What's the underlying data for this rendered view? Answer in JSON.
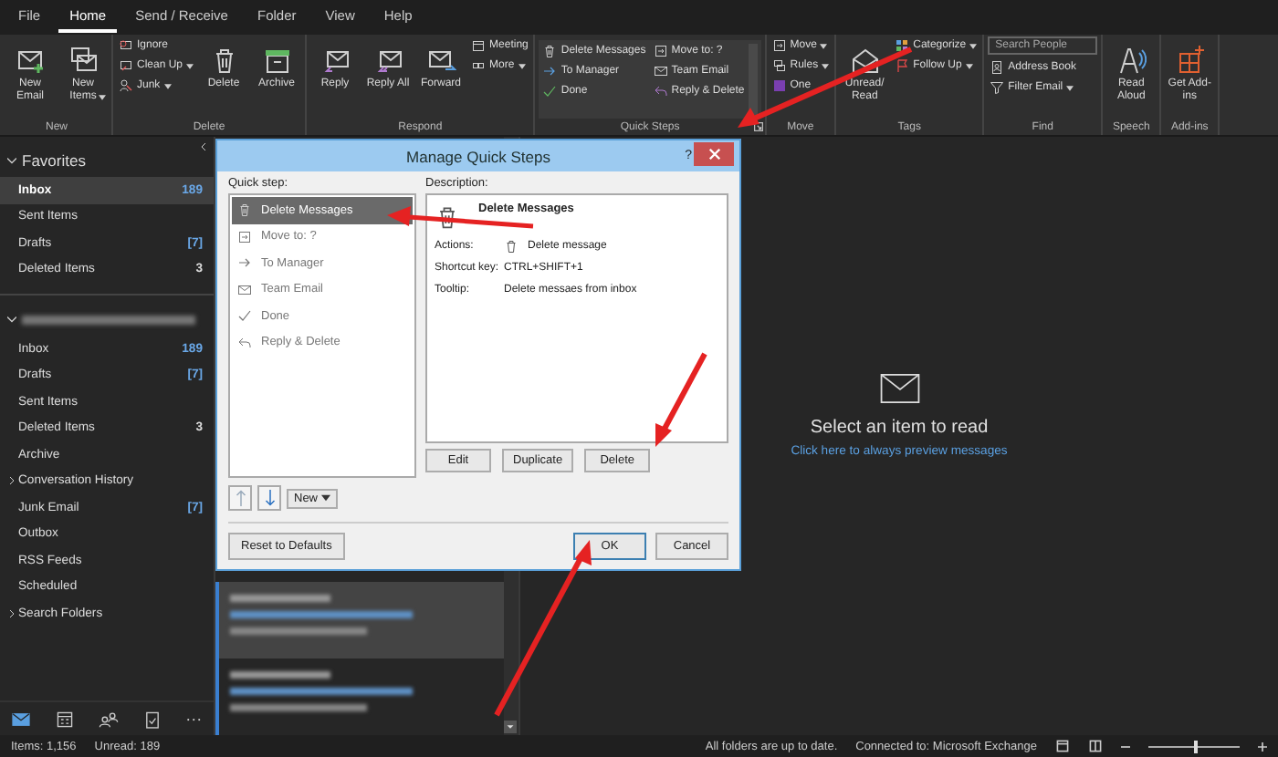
{
  "menu_tabs": [
    {
      "label": "File",
      "selected": false
    },
    {
      "label": "Home",
      "selected": true
    },
    {
      "label": "Send / Receive",
      "selected": false
    },
    {
      "label": "Folder",
      "selected": false
    },
    {
      "label": "View",
      "selected": false
    },
    {
      "label": "Help",
      "selected": false
    }
  ],
  "ribbon": {
    "groups": [
      {
        "label": "New",
        "columns": [
          {
            "kind": "large",
            "items": [
              {
                "label": "New Email",
                "dropdown": false
              }
            ]
          },
          {
            "kind": "large",
            "items": [
              {
                "label": "New Items",
                "dropdown": true
              }
            ]
          }
        ]
      },
      {
        "label": "Delete",
        "columns": [
          {
            "kind": "small",
            "items": [
              {
                "label": "Ignore",
                "dropdown": false
              },
              {
                "label": "Clean Up",
                "dropdown": true
              },
              {
                "label": "Junk",
                "dropdown": true
              }
            ]
          },
          {
            "kind": "large",
            "items": [
              {
                "label": "Delete",
                "dropdown": false
              }
            ]
          },
          {
            "kind": "large",
            "items": [
              {
                "label": "Archive",
                "dropdown": false
              }
            ]
          }
        ]
      },
      {
        "label": "Respond",
        "columns": [
          {
            "kind": "large",
            "items": [
              {
                "label": "Reply",
                "dropdown": false
              }
            ]
          },
          {
            "kind": "large",
            "items": [
              {
                "label": "Reply All",
                "dropdown": false
              }
            ]
          },
          {
            "kind": "large",
            "items": [
              {
                "label": "Forward",
                "dropdown": false
              }
            ]
          },
          {
            "kind": "small",
            "items": [
              {
                "label": "Meeting",
                "dropdown": false
              },
              {
                "label": "More",
                "dropdown": true
              }
            ]
          }
        ]
      },
      {
        "label": "Quick Steps",
        "columns": [
          {
            "kind": "gallery",
            "items": [
              {
                "label": "Delete Messages",
                "dropdown": false
              },
              {
                "label": "To Manager",
                "dropdown": false
              },
              {
                "label": "Done",
                "dropdown": false
              }
            ]
          },
          {
            "kind": "gallery",
            "items": [
              {
                "label": "Move to: ?",
                "dropdown": false
              },
              {
                "label": "Team Email",
                "dropdown": false
              },
              {
                "label": "Reply & Delete",
                "dropdown": false
              }
            ]
          }
        ]
      },
      {
        "label": "Move",
        "columns": [
          {
            "kind": "small",
            "items": [
              {
                "label": "Move",
                "dropdown": true
              },
              {
                "label": "Rules",
                "dropdown": true
              },
              {
                "label": "One",
                "dropdown": false
              }
            ]
          }
        ]
      },
      {
        "label": "Tags",
        "columns": [
          {
            "kind": "large",
            "items": [
              {
                "label": "Unread/ Read",
                "dropdown": false
              }
            ]
          },
          {
            "kind": "small",
            "items": [
              {
                "label": "Categorize",
                "dropdown": true
              },
              {
                "label": "Follow Up",
                "dropdown": true
              }
            ]
          }
        ]
      },
      {
        "label": "Find",
        "columns": [
          {
            "kind": "small",
            "items": [
              {
                "label": "Search People",
                "kind": "field"
              },
              {
                "label": "Address Book",
                "dropdown": false
              },
              {
                "label": "Filter Email",
                "dropdown": true
              }
            ]
          }
        ]
      },
      {
        "label": "Speech",
        "columns": [
          {
            "kind": "large",
            "items": [
              {
                "label": "Read Aloud",
                "dropdown": false
              }
            ]
          }
        ]
      },
      {
        "label": "Add-ins",
        "columns": [
          {
            "kind": "large",
            "items": [
              {
                "label": "Get Add-ins",
                "dropdown": false
              }
            ]
          }
        ]
      }
    ]
  },
  "sidebar": {
    "sections": [
      {
        "title": "Favorites",
        "expanded": true,
        "items": [
          {
            "name": "Inbox",
            "count": "189",
            "selected": true,
            "children": false
          },
          {
            "name": "Sent Items",
            "selected": false,
            "children": false
          },
          {
            "name": "Drafts",
            "count": "[7]",
            "selected": false,
            "children": false
          },
          {
            "name": "Deleted Items",
            "count": "3",
            "selected": false,
            "children": false
          }
        ]
      },
      {
        "kind": "blurred",
        "expanded": true,
        "items": [
          {
            "name": "Inbox",
            "count": "189",
            "selected": false,
            "children": false
          },
          {
            "name": "Drafts",
            "count": "[7]",
            "selected": false,
            "children": false
          },
          {
            "name": "Sent Items",
            "selected": false,
            "children": false
          },
          {
            "name": "Deleted Items",
            "count": "3",
            "selected": false,
            "children": false
          },
          {
            "name": "Archive",
            "selected": false,
            "children": false
          },
          {
            "name": "Conversation History",
            "selected": false,
            "children": true
          },
          {
            "name": "Junk Email",
            "count": "[7]",
            "selected": false,
            "children": false
          },
          {
            "name": "Outbox",
            "selected": false,
            "children": false
          },
          {
            "name": "RSS Feeds",
            "selected": false,
            "children": false
          },
          {
            "name": "Scheduled",
            "selected": false,
            "children": false
          },
          {
            "name": "Search Folders",
            "selected": false,
            "children": true
          }
        ]
      }
    ],
    "nav": [
      {
        "selected": true
      },
      {
        "selected": false
      },
      {
        "selected": false
      },
      {
        "selected": false
      },
      {
        "label": "···",
        "selected": false
      }
    ]
  },
  "message_list": [
    {
      "selected": true
    },
    {
      "selected": false
    }
  ],
  "reading_pane": {
    "message": "Select an item to read",
    "link": "Click here to always preview messages"
  },
  "dialog": {
    "title": "Manage Quick Steps",
    "help": "?",
    "quick_step_label": "Quick step:",
    "quick_steps": [
      {
        "label": "Delete Messages",
        "selected": true
      },
      {
        "label": "Move to: ?",
        "selected": false
      },
      {
        "label": "To Manager",
        "selected": false
      },
      {
        "label": "Team Email",
        "selected": false
      },
      {
        "label": "Done",
        "selected": false
      },
      {
        "label": "Reply & Delete",
        "selected": false
      }
    ],
    "description_label": "Description:",
    "description": {
      "name": "Delete Messages",
      "rows": [
        {
          "label": "Actions:",
          "value": "Delete message",
          "kind": "action"
        },
        {
          "label": "Shortcut key:",
          "value": "CTRL+SHIFT+1",
          "kind": "text"
        },
        {
          "label": "Tooltip:",
          "value": "Delete messaes from inbox",
          "kind": "text"
        }
      ]
    },
    "edit_buttons": [
      "Edit",
      "Duplicate",
      "Delete"
    ],
    "new_button": "New",
    "reset_button": "Reset to Defaults",
    "ok_button": "OK",
    "cancel_button": "Cancel"
  },
  "status_bar": {
    "items": "Items: 1,156",
    "unread": "Unread: 189",
    "sync": "All folders are up to date.",
    "connection": "Connected to: Microsoft Exchange",
    "zoom": {
      "level": 0.5
    }
  }
}
